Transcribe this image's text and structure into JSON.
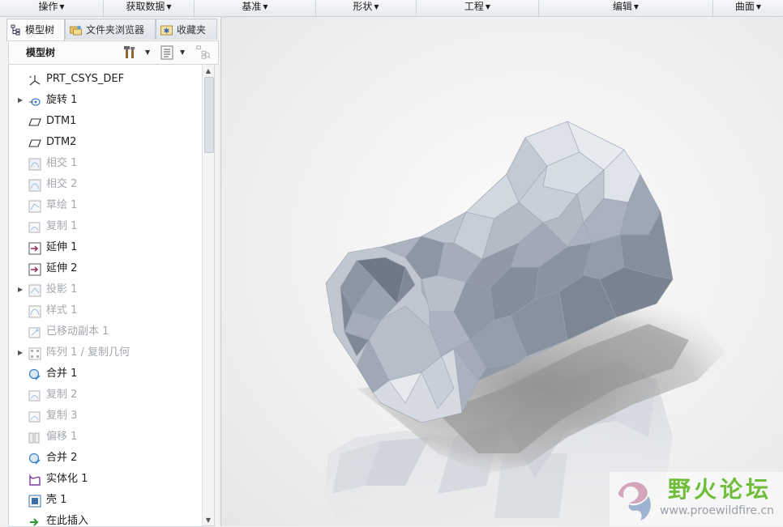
{
  "ribbon": {
    "groups": [
      "操作",
      "获取数据",
      "基准",
      "形状",
      "工程",
      "编辑",
      "曲面"
    ]
  },
  "panel": {
    "tabs": [
      "模型树",
      "文件夹浏览器",
      "收藏夹"
    ],
    "tree_header": "模型树",
    "tree": [
      {
        "label": "PRT_CSYS_DEF",
        "icon": "csys-icon",
        "expandable": false,
        "dimmed": false
      },
      {
        "label": "旋转 1",
        "icon": "revolve-icon",
        "expandable": true,
        "dimmed": false
      },
      {
        "label": "DTM1",
        "icon": "datum-plane-icon",
        "expandable": false,
        "dimmed": false
      },
      {
        "label": "DTM2",
        "icon": "datum-plane-icon",
        "expandable": false,
        "dimmed": false
      },
      {
        "label": "相交 1",
        "icon": "intersect-icon",
        "expandable": false,
        "dimmed": true
      },
      {
        "label": "相交 2",
        "icon": "intersect-icon",
        "expandable": false,
        "dimmed": true
      },
      {
        "label": "草绘 1",
        "icon": "sketch-icon",
        "expandable": false,
        "dimmed": true
      },
      {
        "label": "复制 1",
        "icon": "copy-icon",
        "expandable": false,
        "dimmed": true
      },
      {
        "label": "延伸 1",
        "icon": "extend-icon",
        "expandable": false,
        "dimmed": false
      },
      {
        "label": "延伸 2",
        "icon": "extend-icon",
        "expandable": false,
        "dimmed": false
      },
      {
        "label": "投影 1",
        "icon": "project-icon",
        "expandable": true,
        "dimmed": true
      },
      {
        "label": "样式 1",
        "icon": "style-icon",
        "expandable": false,
        "dimmed": true
      },
      {
        "label": "已移动副本 1",
        "icon": "moved-copy-icon",
        "expandable": false,
        "dimmed": true
      },
      {
        "label": "阵列 1 / 复制几何",
        "icon": "pattern-icon",
        "expandable": true,
        "dimmed": true
      },
      {
        "label": "合并 1",
        "icon": "merge-icon",
        "expandable": false,
        "dimmed": false
      },
      {
        "label": "复制 2",
        "icon": "copy-icon",
        "expandable": false,
        "dimmed": true
      },
      {
        "label": "复制 3",
        "icon": "copy-icon",
        "expandable": false,
        "dimmed": true
      },
      {
        "label": "偏移 1",
        "icon": "offset-icon",
        "expandable": false,
        "dimmed": true
      },
      {
        "label": "合并 2",
        "icon": "merge-icon",
        "expandable": false,
        "dimmed": false
      },
      {
        "label": "实体化 1",
        "icon": "solidify-icon",
        "expandable": false,
        "dimmed": false
      },
      {
        "label": "壳 1",
        "icon": "shell-icon",
        "expandable": false,
        "dimmed": false
      },
      {
        "label": "在此插入",
        "icon": "insert-here-icon",
        "expandable": false,
        "dimmed": false
      }
    ]
  },
  "watermark": {
    "title": "野火论坛",
    "url": "www.proewildfire.cn"
  },
  "colors": {
    "model_face": "#aeb7c4",
    "accent_green": "#6fbe3a"
  }
}
